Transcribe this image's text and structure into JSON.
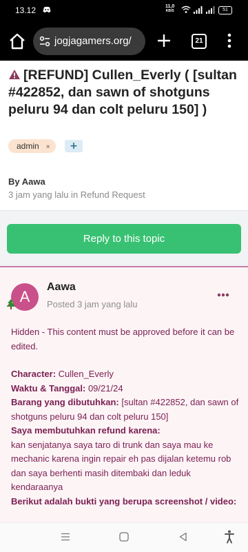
{
  "status": {
    "time": "13.12",
    "speed_top": "11,0",
    "speed_bottom": "KB/S",
    "battery": "51"
  },
  "browser": {
    "url": "jogjagamers.org/",
    "tab_count": "21"
  },
  "topic": {
    "title": "[REFUND] Cullen_Everly ( [sultan #422852, dan sawn of shotguns peluru 94 dan colt peluru 150] )",
    "tag": "admin",
    "tag_remove": "×",
    "add_tag": "+",
    "by": "By Aawa",
    "meta": "3 jam yang lalu in Refund Request"
  },
  "reply_button": "Reply to this topic",
  "post": {
    "avatar_letter": "A",
    "author": "Aawa",
    "posted": "Posted 3 jam yang lalu",
    "hidden_notice": "Hidden - This content must be approved before it can be edited.",
    "fields": [
      {
        "label": "Character:",
        "value": " Cullen_Everly"
      },
      {
        "label": "Waktu & Tanggal:",
        "value": " 09/21/24"
      },
      {
        "label": "Barang yang dibutuhkan:",
        "value": " [sultan #422852, dan sawn of shotguns peluru 94 dan colt peluru 150]"
      }
    ],
    "reason_label": "Saya membutuhkan refund karena:",
    "reason_text": "kan senjatanya saya taro di trunk dan saya mau ke mechanic karena ingin repair eh pas dijalan ketemu rob dan saya berhenti masih ditembaki dan leduk kendaraanya",
    "proof_label": "Berikut adalah bukti yang berupa screenshot / video:"
  },
  "colors": {
    "accent": "#38c172",
    "post_text": "#7a1f52",
    "avatar": "#c9508a",
    "tag_bg": "#fbe3cf"
  }
}
